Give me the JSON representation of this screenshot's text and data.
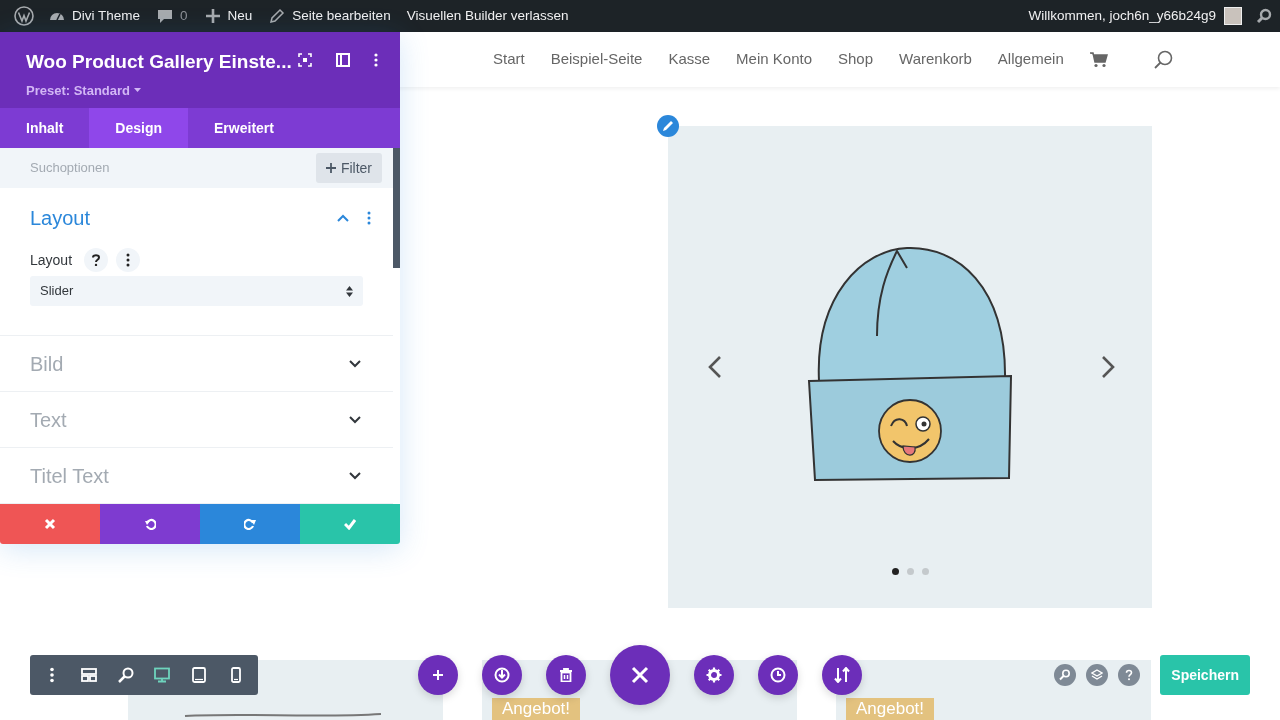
{
  "admin_bar": {
    "items": [
      {
        "kind": "site",
        "label": "Divi Theme"
      },
      {
        "kind": "comments",
        "label": "0"
      },
      {
        "kind": "new",
        "label": "Neu"
      },
      {
        "kind": "edit",
        "label": "Seite bearbeiten"
      },
      {
        "kind": "exit",
        "label": "Visuellen Builder verlassen"
      }
    ],
    "greeting": "Willkommen, joch6n_y66b24g9"
  },
  "site_nav": {
    "items": [
      "Start",
      "Beispiel-Seite",
      "Kasse",
      "Mein Konto",
      "Shop",
      "Warenkorb",
      "Allgemein"
    ]
  },
  "settings_panel": {
    "title": "Woo Product Gallery Einste...",
    "preset": "Preset: Standard",
    "tabs": [
      {
        "label": "Inhalt",
        "selected": false
      },
      {
        "label": "Design",
        "selected": true
      },
      {
        "label": "Erweitert",
        "selected": false
      }
    ],
    "search": {
      "placeholder": "Suchoptionen"
    },
    "filter_button": "Filter",
    "sections": [
      {
        "title": "Layout",
        "expanded": true,
        "fields": [
          {
            "label": "Layout",
            "value": "Slider"
          }
        ]
      },
      {
        "title": "Bild",
        "expanded": false
      },
      {
        "title": "Text",
        "expanded": false
      },
      {
        "title": "Titel Text",
        "expanded": false
      }
    ]
  },
  "gallery": {
    "dots": [
      {
        "selected": true
      },
      {
        "selected": false
      },
      {
        "selected": false
      }
    ]
  },
  "product_cards": [
    {
      "kind": "plain"
    },
    {
      "kind": "sale",
      "badge": "Angebot!"
    },
    {
      "kind": "sale",
      "badge": "Angebot!"
    }
  ],
  "view_modes": [
    {
      "kind": "desktop",
      "selected": true
    },
    {
      "kind": "tablet",
      "selected": false
    },
    {
      "kind": "phone",
      "selected": false
    }
  ],
  "save_button": "Speichern"
}
